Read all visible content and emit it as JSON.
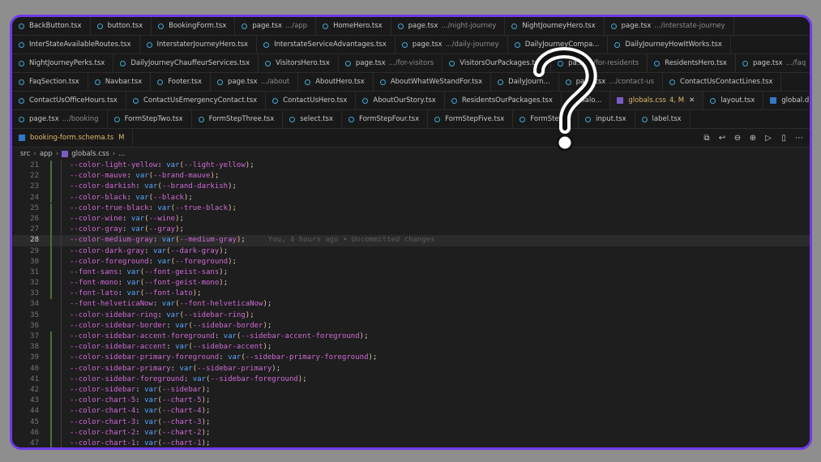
{
  "tab_rows": [
    [
      {
        "label": "BackButton.tsx",
        "icon": "react-icon"
      },
      {
        "label": "button.tsx",
        "icon": "react-icon"
      },
      {
        "label": "BookingForm.tsx",
        "icon": "react-icon"
      },
      {
        "label": "page.tsx",
        "desc": ".../app",
        "icon": "react-icon"
      },
      {
        "label": "HomeHero.tsx",
        "icon": "react-icon"
      },
      {
        "label": "page.tsx",
        "desc": ".../night-journey",
        "icon": "react-icon"
      },
      {
        "label": "NightJourneyHero.tsx",
        "icon": "react-icon"
      },
      {
        "label": "page.tsx",
        "desc": ".../interstate-journey",
        "icon": "react-icon"
      }
    ],
    [
      {
        "label": "InterStateAvailableRoutes.tsx",
        "icon": "react-icon"
      },
      {
        "label": "InterstaterJourneyHero.tsx",
        "icon": "react-icon"
      },
      {
        "label": "InterstateServiceAdvantages.tsx",
        "icon": "react-icon"
      },
      {
        "label": "page.tsx",
        "desc": ".../daily-journey",
        "icon": "react-icon"
      },
      {
        "label": "DailyJourneyCompa...",
        "icon": "react-icon"
      },
      {
        "label": "DailyJourneyHowItWorks.tsx",
        "icon": "react-icon"
      }
    ],
    [
      {
        "label": "NightJourneyPerks.tsx",
        "icon": "react-icon"
      },
      {
        "label": "DailyJourneyChauffeurServices.tsx",
        "icon": "react-icon"
      },
      {
        "label": "VisitorsHero.tsx",
        "icon": "react-icon"
      },
      {
        "label": "page.tsx",
        "desc": ".../for-visitors",
        "icon": "react-icon"
      },
      {
        "label": "VisitorsOurPackages.tsx",
        "icon": "react-icon"
      },
      {
        "label": "pa...",
        "desc": ".../for-residents",
        "icon": "react-icon"
      },
      {
        "label": "ResidentsHero.tsx",
        "icon": "react-icon"
      },
      {
        "label": "page.tsx",
        "desc": ".../faq",
        "icon": "react-icon"
      }
    ],
    [
      {
        "label": "FaqSection.tsx",
        "icon": "react-icon"
      },
      {
        "label": "Navbar.tsx",
        "icon": "react-icon"
      },
      {
        "label": "Footer.tsx",
        "icon": "react-icon"
      },
      {
        "label": "page.tsx",
        "desc": ".../about",
        "icon": "react-icon"
      },
      {
        "label": "AboutHero.tsx",
        "icon": "react-icon"
      },
      {
        "label": "AboutWhatWeStandFor.tsx",
        "icon": "react-icon"
      },
      {
        "label": "DailyJourn...",
        "icon": "react-icon"
      },
      {
        "label": "page.tsx",
        "desc": ".../contact-us",
        "icon": "react-icon"
      },
      {
        "label": "ContactUsContactLines.tsx",
        "icon": "react-icon"
      }
    ],
    [
      {
        "label": "ContactUsOfficeHours.tsx",
        "icon": "react-icon"
      },
      {
        "label": "ContactUsEmergencyContact.tsx",
        "icon": "react-icon"
      },
      {
        "label": "ContactUsHero.tsx",
        "icon": "react-icon"
      },
      {
        "label": "AboutOurStory.tsx",
        "icon": "react-icon"
      },
      {
        "label": "ResidentsOurPackages.tsx",
        "icon": "react-icon"
      },
      {
        "label": "dialo...",
        "icon": "react-icon"
      },
      {
        "label": "globals.css",
        "badge": "4, M",
        "icon": "css-icon",
        "active": true
      },
      {
        "label": "layout.tsx",
        "icon": "react-icon"
      },
      {
        "label": "global.d.ts",
        "icon": "ts-icon"
      }
    ],
    [
      {
        "label": "page.tsx",
        "desc": ".../booking",
        "icon": "react-icon"
      },
      {
        "label": "FormStepTwo.tsx",
        "icon": "react-icon"
      },
      {
        "label": "FormStepThree.tsx",
        "icon": "react-icon"
      },
      {
        "label": "select.tsx",
        "icon": "react-icon"
      },
      {
        "label": "FormStepFour.tsx",
        "icon": "react-icon"
      },
      {
        "label": "FormStepFive.tsx",
        "icon": "react-icon"
      },
      {
        "label": "FormStep...",
        "icon": "react-icon"
      },
      {
        "label": "input.tsx",
        "icon": "react-icon"
      },
      {
        "label": "label.tsx",
        "icon": "react-icon"
      }
    ]
  ],
  "extra_tab": {
    "label": "booking-form.schema.ts",
    "modified": "M"
  },
  "breadcrumb": {
    "parts": [
      "src",
      "app",
      "globals.css",
      "..."
    ]
  },
  "code_lines": [
    {
      "n": "21",
      "prop": "--color-light-yellow",
      "arg": "--light-yellow"
    },
    {
      "n": "22",
      "prop": "--color-mauve",
      "arg": "--brand-mauve"
    },
    {
      "n": "23",
      "prop": "--color-darkish",
      "arg": "--brand-darkish"
    },
    {
      "n": "24",
      "prop": "--color-black",
      "arg": "--black"
    },
    {
      "n": "25",
      "prop": "--color-true-black",
      "arg": "--true-black"
    },
    {
      "n": "26",
      "prop": "--color-wine",
      "arg": "--wine"
    },
    {
      "n": "27",
      "prop": "--color-gray",
      "arg": "--gray"
    },
    {
      "n": "28",
      "prop": "--color-medium-gray",
      "arg": "--medium-gray",
      "current": true,
      "blame": "You, 4 hours ago • Uncommitted changes"
    },
    {
      "n": "29",
      "prop": "--color-dark-gray",
      "arg": "--dark-gray"
    },
    {
      "n": "30",
      "prop": "--color-foreground",
      "arg": "--foreground"
    },
    {
      "n": "31",
      "prop": "--font-sans",
      "arg": "--font-geist-sans"
    },
    {
      "n": "32",
      "prop": "--font-mono",
      "arg": "--font-geist-mono"
    },
    {
      "n": "33",
      "prop": "--font-lato",
      "arg": "--font-lato"
    },
    {
      "n": "34",
      "prop": "--font-helveticaNow",
      "arg": "--font-helveticaNow"
    },
    {
      "n": "35",
      "prop": "--color-sidebar-ring",
      "arg": "--sidebar-ring"
    },
    {
      "n": "36",
      "prop": "--color-sidebar-border",
      "arg": "--sidebar-border"
    },
    {
      "n": "37",
      "prop": "--color-sidebar-accent-foreground",
      "arg": "--sidebar-accent-foreground"
    },
    {
      "n": "38",
      "prop": "--color-sidebar-accent",
      "arg": "--sidebar-accent"
    },
    {
      "n": "39",
      "prop": "--color-sidebar-primary-foreground",
      "arg": "--sidebar-primary-foreground"
    },
    {
      "n": "40",
      "prop": "--color-sidebar-primary",
      "arg": "--sidebar-primary"
    },
    {
      "n": "41",
      "prop": "--color-sidebar-foreground",
      "arg": "--sidebar-foreground"
    },
    {
      "n": "42",
      "prop": "--color-sidebar",
      "arg": "--sidebar"
    },
    {
      "n": "43",
      "prop": "--color-chart-5",
      "arg": "--chart-5"
    },
    {
      "n": "44",
      "prop": "--color-chart-4",
      "arg": "--chart-4"
    },
    {
      "n": "45",
      "prop": "--color-chart-3",
      "arg": "--chart-3"
    },
    {
      "n": "46",
      "prop": "--color-chart-2",
      "arg": "--chart-2"
    },
    {
      "n": "47",
      "prop": "--color-chart-1",
      "arg": "--chart-1"
    }
  ],
  "colors": {
    "frame": "#6f3be8",
    "active_tab": "#e0b96a",
    "property": "#d16ad8",
    "function": "#58a6ff"
  }
}
